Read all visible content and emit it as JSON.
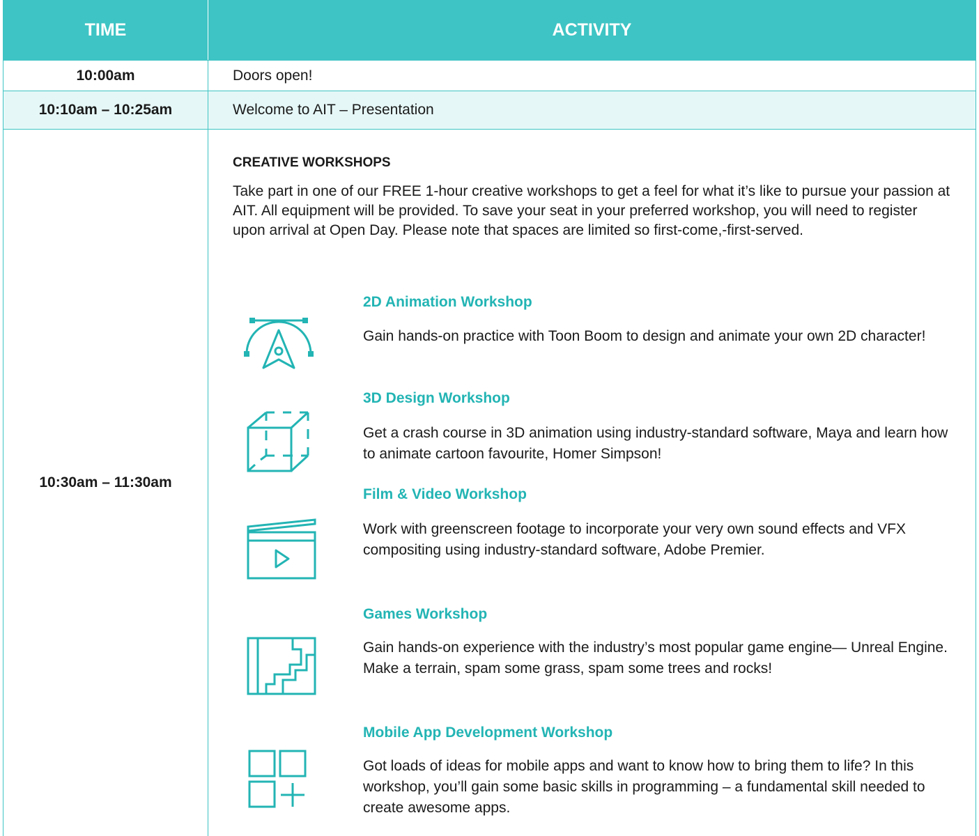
{
  "header": {
    "time": "TIME",
    "activity": "ACTIVITY"
  },
  "rows": [
    {
      "time": "10:00am",
      "activity": "Doors open!"
    },
    {
      "time": "10:10am – 10:25am",
      "activity": "Welcome to AIT – Presentation"
    },
    {
      "time": "10:30am – 11:30am"
    }
  ],
  "workshops_section": {
    "title": "CREATIVE WORKSHOPS",
    "intro": "Take part in one of our FREE 1-hour creative workshops to get a feel for what it’s like to pursue your passion at AIT. All equipment will be provided. To save your seat in your preferred workshop, you will need to register upon arrival at Open Day. Please note that spaces are limited so first-come,-first-served.",
    "workshops": [
      {
        "title": "2D Animation Workshop",
        "icon": "bezier-pen-icon",
        "description": "Gain hands-on practice with Toon Boom to design and animate your own 2D character!"
      },
      {
        "title": "3D Design Workshop",
        "icon": "cube-icon",
        "description": "Get a crash course in 3D animation using industry-standard software, Maya and learn how to animate cartoon favourite, Homer Simpson!"
      },
      {
        "title": "Film & Video Workshop",
        "icon": "clapperboard-icon",
        "description": "Work with greenscreen footage to incorporate your very own sound effects and VFX compositing using industry-standard software, Adobe Premier."
      },
      {
        "title": "Games Workshop",
        "icon": "game-map-icon",
        "description": "Gain hands-on experience with the industry’s most popular game engine— Unreal Engine. Make a terrain, spam some grass, spam some trees and rocks!"
      },
      {
        "title": "Mobile App Development Workshop",
        "icon": "app-grid-icon",
        "description": "Got loads of ideas for mobile apps and want to know how to bring them to life? In this workshop, you’ll gain some basic skills in programming – a fundamental skill needed to create awesome apps."
      }
    ]
  },
  "colors": {
    "accent": "#3ec4c4",
    "accent_text": "#23b4b4",
    "row_tint": "#e6f7f7"
  }
}
